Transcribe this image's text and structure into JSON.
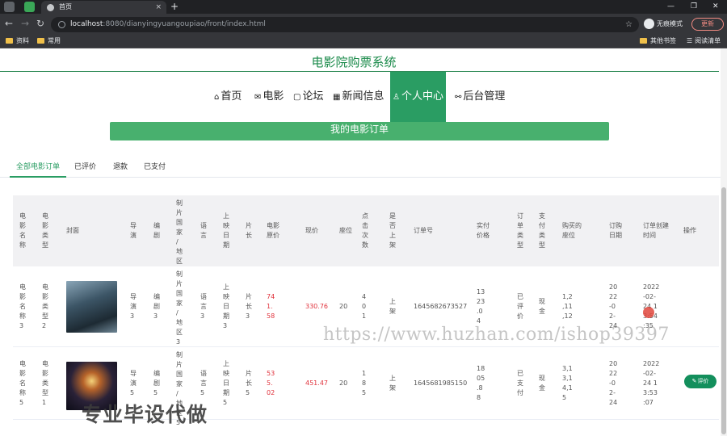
{
  "browser": {
    "tab_title": "首页",
    "tab_close": "×",
    "new_tab": "+",
    "window_controls": [
      "—",
      "❐",
      "✕"
    ],
    "nav": {
      "back": "←",
      "forward": "→",
      "reload": "↻"
    },
    "url_host": "localhost",
    "url_rest": ":8080/dianyingyuangoupiao/front/index.html",
    "star": "☆",
    "incognito_label": "无痕模式",
    "update_label": "更新",
    "bookmarks": [
      "资料",
      "常用"
    ],
    "bookmarks_right": [
      "其他书签",
      "阅读清单"
    ]
  },
  "site": {
    "title": "电影院购票系统",
    "nav": [
      {
        "icon": "⌂",
        "label": "首页"
      },
      {
        "icon": "✉",
        "label": "电影"
      },
      {
        "icon": "▢",
        "label": "论坛"
      },
      {
        "icon": "▦",
        "label": "新闻信息"
      },
      {
        "icon": "♙",
        "label": "个人中心"
      },
      {
        "icon": "⚯",
        "label": "后台管理"
      }
    ],
    "active_nav": "个人中心"
  },
  "page": {
    "banner_title": "我的电影订单",
    "subtabs": [
      "全部电影订单",
      "已评价",
      "退款",
      "已支付"
    ],
    "active_subtab": "全部电影订单"
  },
  "table": {
    "headers": [
      "电影名称",
      "电影类型",
      "封面",
      "导演",
      "编剧",
      "制片国家/地区",
      "语言",
      "上映日期",
      "片长",
      "电影原价",
      "现价",
      "座位",
      "点击次数",
      "是否上架",
      "订单号",
      "实付价格",
      "订单类型",
      "支付类型",
      "购买的座位",
      "订购日期",
      "订单创建时间",
      "操作"
    ],
    "rows": [
      {
        "name": "电影名称3",
        "type": "电影类型2",
        "director": "导演3",
        "writer": "编剧3",
        "country": "制片国家/地区3",
        "language": "语言3",
        "release": "上映日期3",
        "length": "片长3",
        "original_price": "741.58",
        "price": "330.76",
        "seat": "20",
        "clicks": "401",
        "listed": "上架",
        "order_no": "1645682673527",
        "paid": "1323.04",
        "order_type": "已评价",
        "pay_type": "现金",
        "seats_bought": "1,2,11,12",
        "order_date": "2022-02-24",
        "created": "2022-02-24 13:54:35",
        "action": ""
      },
      {
        "name": "电影名称5",
        "type": "电影类型1",
        "director": "导演5",
        "writer": "编剧5",
        "country": "制片国家/地区5",
        "language": "语言5",
        "release": "上映日期5",
        "length": "片长5",
        "original_price": "535.02",
        "price": "451.47",
        "seat": "20",
        "clicks": "185",
        "listed": "上架",
        "order_no": "1645681985150",
        "paid": "1805.88",
        "order_type": "已支付",
        "pay_type": "现金",
        "seats_bought": "3,13,14,15",
        "order_date": "2022-02-24",
        "created": "2022-02-24 13:53:07",
        "action": "评价"
      }
    ]
  },
  "overlays": {
    "watermark": "https://www.huzhan.com/ishop39397",
    "promo": "专业毕设代做"
  },
  "colors": {
    "accent": "#2a9d63",
    "price_red": "#e0323c",
    "banner": "#48b06e"
  }
}
